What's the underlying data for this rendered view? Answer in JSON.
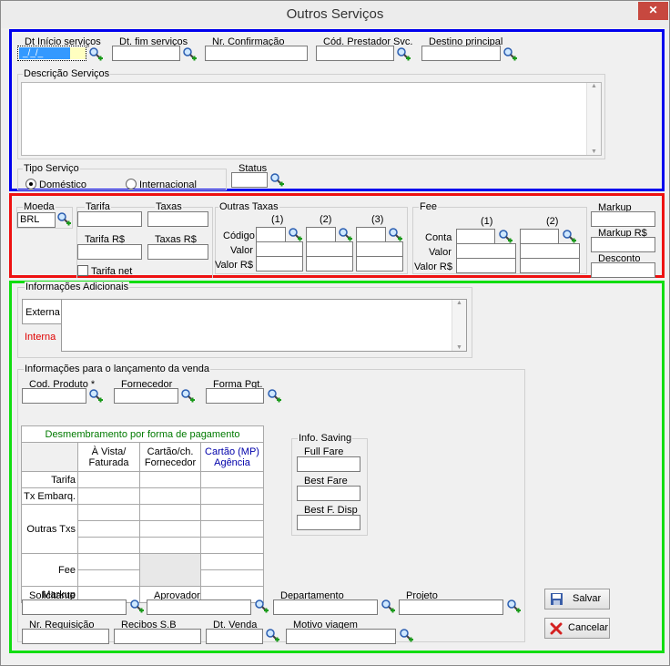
{
  "window": {
    "title": "Outros Serviços",
    "close_glyph": "✕"
  },
  "top": {
    "dt_inicio": "Dt Início serviços",
    "dt_inicio_value": "_/_/_",
    "dt_fim": "Dt. fim serviços",
    "nr_confirmacao": "Nr. Confirmação",
    "cod_prestador": "Cód. Prestador Svc.",
    "destino": "Destino principal",
    "descricao": "Descrição Serviços",
    "tipo_servico": "Tipo Serviço",
    "domestico": "Doméstico",
    "internacional": "Internacional",
    "status": "Status"
  },
  "mid": {
    "moeda": "Moeda",
    "moeda_value": "BRL",
    "tarifa": "Tarifa",
    "taxas": "Taxas",
    "tarifa_rs": "Tarifa R$",
    "taxas_rs": "Taxas R$",
    "tarifa_net": "Tarifa net",
    "outras_taxas": "Outras Taxas",
    "col1": "(1)",
    "col2": "(2)",
    "col3": "(3)",
    "codigo": "Código",
    "valor": "Valor",
    "valor_rs": "Valor R$",
    "fee": "Fee",
    "conta": "Conta",
    "markup": "Markup",
    "markup_rs": "Markup R$",
    "desconto": "Desconto"
  },
  "bottom": {
    "info_adicionais": "Informações Adicionais",
    "tab_externa": "Externa",
    "tab_interna": "Interna",
    "info_lancamento": "Informações para o lançamento da venda",
    "cod_produto": "Cod. Produto *",
    "fornecedor": "Fornecedor",
    "forma_pgt": "Forma Pgt.",
    "desmembramento": "Desmembramento por forma de pagamento",
    "h1a": "À Vista/",
    "h1b": "Faturada",
    "h2a": "Cartão/ch.",
    "h2b": "Fornecedor",
    "h3a": "Cartão (MP)",
    "h3b": "Agência",
    "r_tarifa": "Tarifa",
    "r_tx_embarq": "Tx Embarq.",
    "r_outras_txs": "Outras Txs",
    "r_fee": "Fee",
    "r_markup": "Markup",
    "info_saving": "Info. Saving",
    "full_fare": "Full Fare",
    "best_fare": "Best Fare",
    "best_f_disp": "Best F. Disp",
    "solicitante": "Solicitante",
    "aprovador": "Aprovador",
    "departamento": "Departamento",
    "projeto": "Projeto",
    "nr_requisicao": "Nr. Requisição",
    "recibos_sb": "Recibos S.B",
    "dt_venda": "Dt. Venda",
    "motivo_viagem": "Motivo viagem",
    "salvar": "Salvar",
    "cancelar": "Cancelar"
  },
  "colors": {
    "blue_frame": "#0000ee",
    "red_frame": "#ee1111",
    "green_frame": "#11dd11",
    "green_title": "#007a00",
    "blue_header": "#0000aa",
    "interna_tab": "#e00000"
  },
  "icons": [
    "search-add-icon",
    "close-icon",
    "save-icon",
    "cancel-icon",
    "scroll-up-icon",
    "scroll-down-icon"
  ]
}
